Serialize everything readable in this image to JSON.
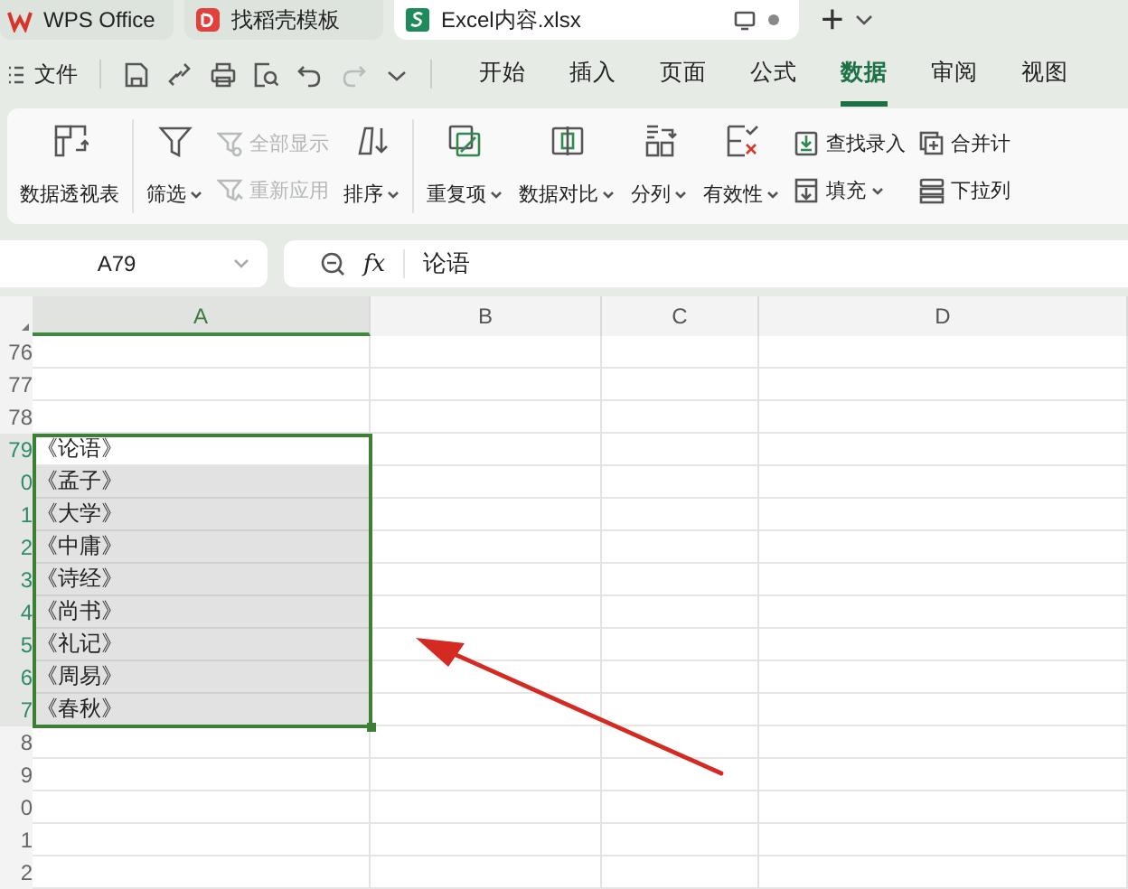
{
  "tabs": [
    {
      "label": "WPS Office",
      "selected": false
    },
    {
      "label": "找稻壳模板",
      "selected": false
    },
    {
      "label": "Excel内容.xlsx",
      "selected": true
    }
  ],
  "new_tab": "+",
  "menu": {
    "file": "文件",
    "quick_access": [
      {
        "disabled": false
      },
      {
        "disabled": false
      },
      {
        "disabled": false
      },
      {
        "disabled": false
      },
      {
        "disabled": false
      },
      {
        "disabled": true
      },
      {
        "disabled": false
      }
    ],
    "tabs": [
      {
        "label": "开始",
        "selected": false
      },
      {
        "label": "插入",
        "selected": false
      },
      {
        "label": "页面",
        "selected": false
      },
      {
        "label": "公式",
        "selected": false
      },
      {
        "label": "数据",
        "selected": true
      },
      {
        "label": "审阅",
        "selected": false
      },
      {
        "label": "视图",
        "selected": false
      }
    ]
  },
  "ribbon": [
    [
      {
        "kind": "large",
        "label": "数据透视表",
        "dropdown": false
      }
    ],
    [
      {
        "kind": "large",
        "label": "筛选",
        "dropdown": true
      },
      {
        "kind": "stack",
        "items": [
          {
            "label": "全部显示",
            "disabled": true,
            "dropdown": false
          },
          {
            "label": "重新应用",
            "disabled": true,
            "dropdown": false
          }
        ]
      },
      {
        "kind": "large",
        "label": "排序",
        "dropdown": true
      }
    ],
    [
      {
        "kind": "large",
        "label": "重复项",
        "dropdown": true
      },
      {
        "kind": "large",
        "label": "数据对比",
        "dropdown": true
      },
      {
        "kind": "large",
        "label": "分列",
        "dropdown": true
      },
      {
        "kind": "large",
        "label": "有效性",
        "dropdown": true
      },
      {
        "kind": "stack",
        "items": [
          {
            "label": "查找录入",
            "disabled": false,
            "dropdown": false
          },
          {
            "label": "填充",
            "disabled": false,
            "dropdown": true
          }
        ]
      },
      {
        "kind": "stack",
        "items": [
          {
            "label": "合并计",
            "disabled": false,
            "dropdown": false
          },
          {
            "label": "下拉列",
            "disabled": false,
            "dropdown": false
          }
        ]
      }
    ]
  ],
  "formula_bar": {
    "name_box": "A79",
    "fx": "fx",
    "value": "论语"
  },
  "sheet": {
    "columns": [
      {
        "label": "A",
        "selected": true
      },
      {
        "label": "B",
        "selected": false
      },
      {
        "label": "C",
        "selected": false
      },
      {
        "label": "D",
        "selected": false
      }
    ],
    "rows": [
      {
        "number": "76",
        "selected": false,
        "active": false
      },
      {
        "number": "77",
        "selected": false,
        "active": false
      },
      {
        "number": "78",
        "selected": false,
        "active": false
      },
      {
        "number": "79",
        "value": "《论语》",
        "selected": true,
        "active": true
      },
      {
        "number": "0",
        "value": "《孟子》",
        "selected": true,
        "active": false
      },
      {
        "number": "1",
        "value": "《大学》",
        "selected": true,
        "active": false
      },
      {
        "number": "2",
        "value": "《中庸》",
        "selected": true,
        "active": false
      },
      {
        "number": "3",
        "value": "《诗经》",
        "selected": true,
        "active": false
      },
      {
        "number": "4",
        "value": "《尚书》",
        "selected": true,
        "active": false
      },
      {
        "number": "5",
        "value": "《礼记》",
        "selected": true,
        "active": false
      },
      {
        "number": "6",
        "value": "《周易》",
        "selected": true,
        "active": false
      },
      {
        "number": "7",
        "value": "《春秋》",
        "selected": true,
        "active": false
      },
      {
        "number": "8",
        "selected": false,
        "active": false
      },
      {
        "number": "9",
        "selected": false,
        "active": false
      },
      {
        "number": "0",
        "selected": false,
        "active": false
      },
      {
        "number": "1",
        "selected": false,
        "active": false
      },
      {
        "number": "2",
        "selected": false,
        "active": false
      }
    ]
  }
}
